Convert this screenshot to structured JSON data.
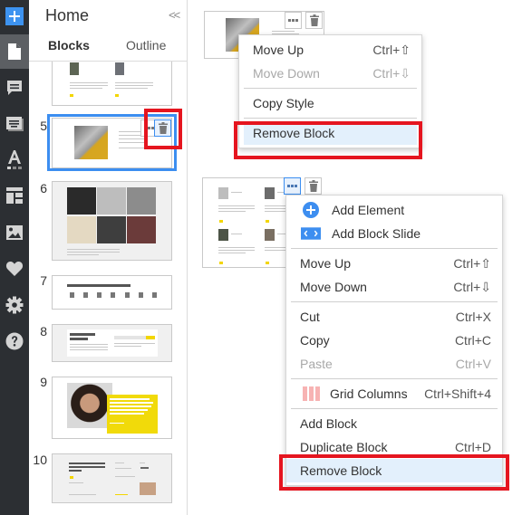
{
  "rail": {
    "items": [
      {
        "icon": "add-icon",
        "active": false
      },
      {
        "icon": "page-icon",
        "active": true
      },
      {
        "icon": "comment-icon",
        "active": false
      },
      {
        "icon": "text-block-icon",
        "active": false
      },
      {
        "icon": "typography-icon",
        "active": false
      },
      {
        "icon": "layout-icon",
        "active": false
      },
      {
        "icon": "image-icon",
        "active": false
      },
      {
        "icon": "heart-icon",
        "active": false
      },
      {
        "icon": "gear-icon",
        "active": false
      },
      {
        "icon": "help-icon",
        "active": false
      }
    ],
    "accent": "#3d93f0"
  },
  "panel": {
    "title": "Home",
    "collapse_label": "<<",
    "tabs": [
      {
        "label": "Blocks",
        "active": true
      },
      {
        "label": "Outline",
        "active": false
      }
    ],
    "blocks": [
      {
        "number": "",
        "preview": "team-members"
      },
      {
        "number": "5",
        "preview": "portrait-yellow-hoodie",
        "selected": true
      },
      {
        "number": "6",
        "preview": "image-gallery"
      },
      {
        "number": "7",
        "preview": "clients-logos",
        "heading": "Here are some of our clients"
      },
      {
        "number": "8",
        "preview": "subscribe-form",
        "heading": "Looking for Best Company?"
      },
      {
        "number": "9",
        "preview": "quote-yellow",
        "heading": "We believe that people can be truly happy on the outside only after reaching happiness within."
      },
      {
        "number": "10",
        "preview": "footer",
        "heading": "Since 2003, we've helped raise more than"
      }
    ]
  },
  "menu_top": {
    "items": [
      {
        "label": "Move Up",
        "shortcut": "Ctrl+⇧",
        "disabled": false
      },
      {
        "label": "Move Down",
        "shortcut": "Ctrl+⇩",
        "disabled": true
      },
      {
        "label": "Copy Style",
        "shortcut": "",
        "disabled": false
      },
      {
        "label": "Remove Block",
        "shortcut": "",
        "disabled": false,
        "highlighted": true
      }
    ]
  },
  "menu_main": {
    "items": [
      {
        "label": "Add Element",
        "icon": "plus-circle-icon"
      },
      {
        "label": "Add Block Slide",
        "icon": "slider-arrows-icon"
      },
      {
        "label": "Move Up",
        "shortcut": "Ctrl+⇧"
      },
      {
        "label": "Move Down",
        "shortcut": "Ctrl+⇩"
      },
      {
        "label": "Cut",
        "shortcut": "Ctrl+X"
      },
      {
        "label": "Copy",
        "shortcut": "Ctrl+C"
      },
      {
        "label": "Paste",
        "shortcut": "Ctrl+V",
        "disabled": true
      },
      {
        "label": "Grid Columns",
        "shortcut": "Ctrl+Shift+4",
        "icon": "grid-columns-icon"
      },
      {
        "label": "Add Block",
        "shortcut": ""
      },
      {
        "label": "Duplicate Block",
        "shortcut": "Ctrl+D"
      },
      {
        "label": "Remove Block",
        "shortcut": "",
        "highlighted": true
      }
    ]
  },
  "colors": {
    "highlight_box": "#e5151f",
    "selection": "#3c8ef0",
    "menu_hover": "#e3f0fc",
    "brand_yellow": "#f3d600"
  }
}
